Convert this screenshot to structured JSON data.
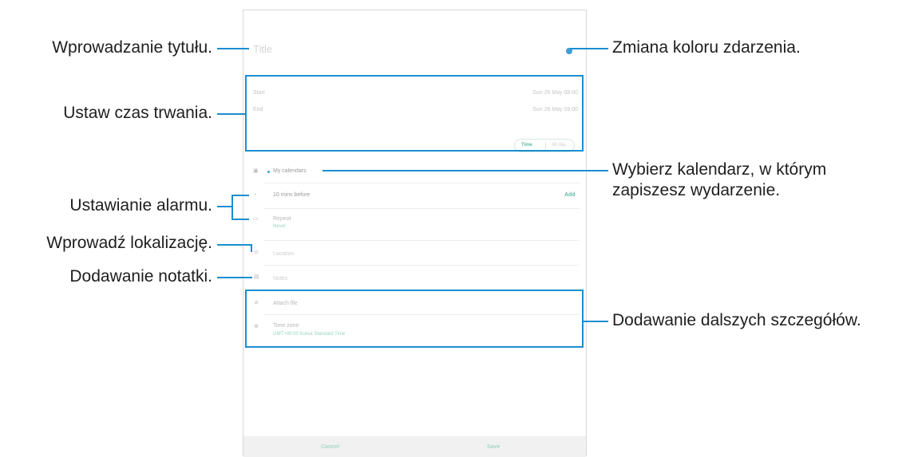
{
  "screen": {
    "title_placeholder": "Title",
    "start_label": "Start",
    "start_value": "Sun 26 May  08:00",
    "end_label": "End",
    "end_value": "Sun 26 May  09:00",
    "time_toggle": "Time",
    "allday_toggle": "All day",
    "calendar_name": "My calendars",
    "alarm_text": "10 mins before",
    "alarm_add": "Add",
    "repeat_text": "Repeat",
    "repeat_sub": "Never",
    "location_placeholder": "Location",
    "notes_placeholder": "Notes",
    "attach_text": "Attach file",
    "timezone_text": "Time zone",
    "timezone_sub": "GMT+09:00 Korea Standard Time",
    "cancel_label": "Cancel",
    "save_label": "Save",
    "event_color": "#3f9fd8"
  },
  "annotations": {
    "title": "Wprowadzanie tytułu.",
    "duration": "Ustaw czas trwania.",
    "alarm": "Ustawianie alarmu.",
    "location": "Wprowadź lokalizację.",
    "notes": "Dodawanie notatki.",
    "color": "Zmiana koloru zdarzenia.",
    "calendar_line1": "Wybierz kalendarz, w którym",
    "calendar_line2": "zapiszesz wydarzenie.",
    "details": "Dodawanie dalszych szczegółów."
  },
  "colors": {
    "callout": "#1b8ed0",
    "accent": "#62bba6"
  },
  "icons": [
    "calendar-icon",
    "bell-icon",
    "repeat-icon",
    "location-icon",
    "notes-icon",
    "attach-icon",
    "globe-icon"
  ]
}
